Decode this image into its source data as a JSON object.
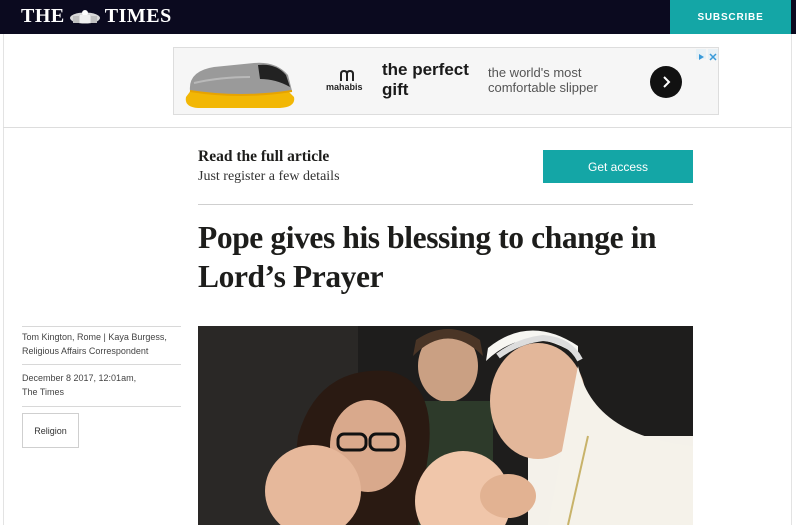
{
  "header": {
    "logo_left": "THE",
    "logo_right": "TIMES",
    "subscribe_label": "SUBSCRIBE",
    "brand_color": "#0b0a1f",
    "accent_color": "#14a6a6"
  },
  "ad": {
    "brand": "mahabis",
    "headline_line1": "the perfect",
    "headline_line2": "gift",
    "copy_line1": "the world's most",
    "copy_line2": "comfortable slipper",
    "arrow_icon": "chevron-right-icon"
  },
  "register": {
    "title": "Read the full article",
    "subtitle": "Just register a few details",
    "button_label": "Get access"
  },
  "article": {
    "headline_line1": "Pope gives his blessing to change in",
    "headline_line2": "Lord’s Prayer",
    "byline_line1": "Tom Kington, Rome | Kaya Burgess,",
    "byline_line2": "Religious Affairs Correspondent",
    "date_line1": "December 8 2017, 12:01am,",
    "date_line2": "The Times",
    "tag": "Religion"
  }
}
